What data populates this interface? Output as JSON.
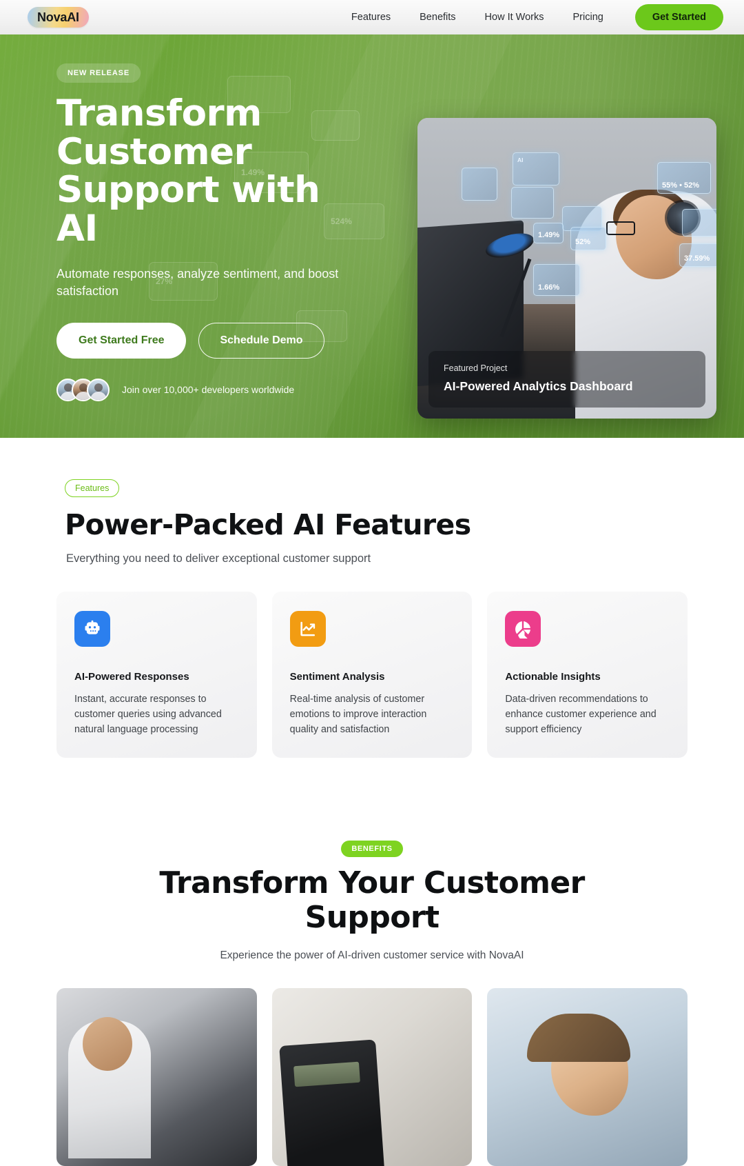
{
  "nav": {
    "logo": "NovaAI",
    "links": [
      {
        "label": "Features"
      },
      {
        "label": "Benefits"
      },
      {
        "label": "How It Works"
      },
      {
        "label": "Pricing"
      }
    ],
    "cta": "Get Started"
  },
  "hero": {
    "badge": "NEW RELEASE",
    "title": "Transform Customer Support with AI",
    "subtitle": "Automate responses, analyze sentiment, and boost satisfaction",
    "primary_btn": "Get Started Free",
    "secondary_btn": "Schedule Demo",
    "social_proof": "Join over 10,000+ developers worldwide",
    "image_card": {
      "overlay_label": "Featured Project",
      "overlay_title": "AI-Powered Analytics Dashboard",
      "hud_stats": [
        "1.49%",
        "52%",
        "27%",
        "1.66%",
        "37.59%",
        "55% • 52%",
        "524%"
      ]
    },
    "accent_color": "#5d9e2a"
  },
  "features": {
    "badge": "Features",
    "title": "Power-Packed AI Features",
    "subtitle": "Everything you need to deliver exceptional customer support",
    "cards": [
      {
        "icon": "robot-icon",
        "icon_color": "#2b7fee",
        "title": "AI-Powered Responses",
        "desc": "Instant, accurate responses to customer queries using advanced natural language processing"
      },
      {
        "icon": "chart-line-up-icon",
        "icon_color": "#f29c12",
        "title": "Sentiment Analysis",
        "desc": "Real-time analysis of customer emotions to improve interaction quality and satisfaction"
      },
      {
        "icon": "pie-chart-icon",
        "icon_color": "#ec3d8b",
        "title": "Actionable Insights",
        "desc": "Data-driven recommendations to enhance customer experience and support efficiency"
      }
    ]
  },
  "benefits": {
    "badge": "BENEFITS",
    "title": "Transform Your Customer Support",
    "subtitle": "Experience the power of AI-driven customer service with NovaAI",
    "gallery": [
      {
        "alt": "call-center-agents-with-headsets"
      },
      {
        "alt": "calculator-on-financial-documents"
      },
      {
        "alt": "smiling-woman-on-phone"
      }
    ]
  },
  "theme": {
    "brand_green": "#7ed321",
    "nav_cta_green": "#6cc81b",
    "hero_green": "#5d9e2a"
  }
}
